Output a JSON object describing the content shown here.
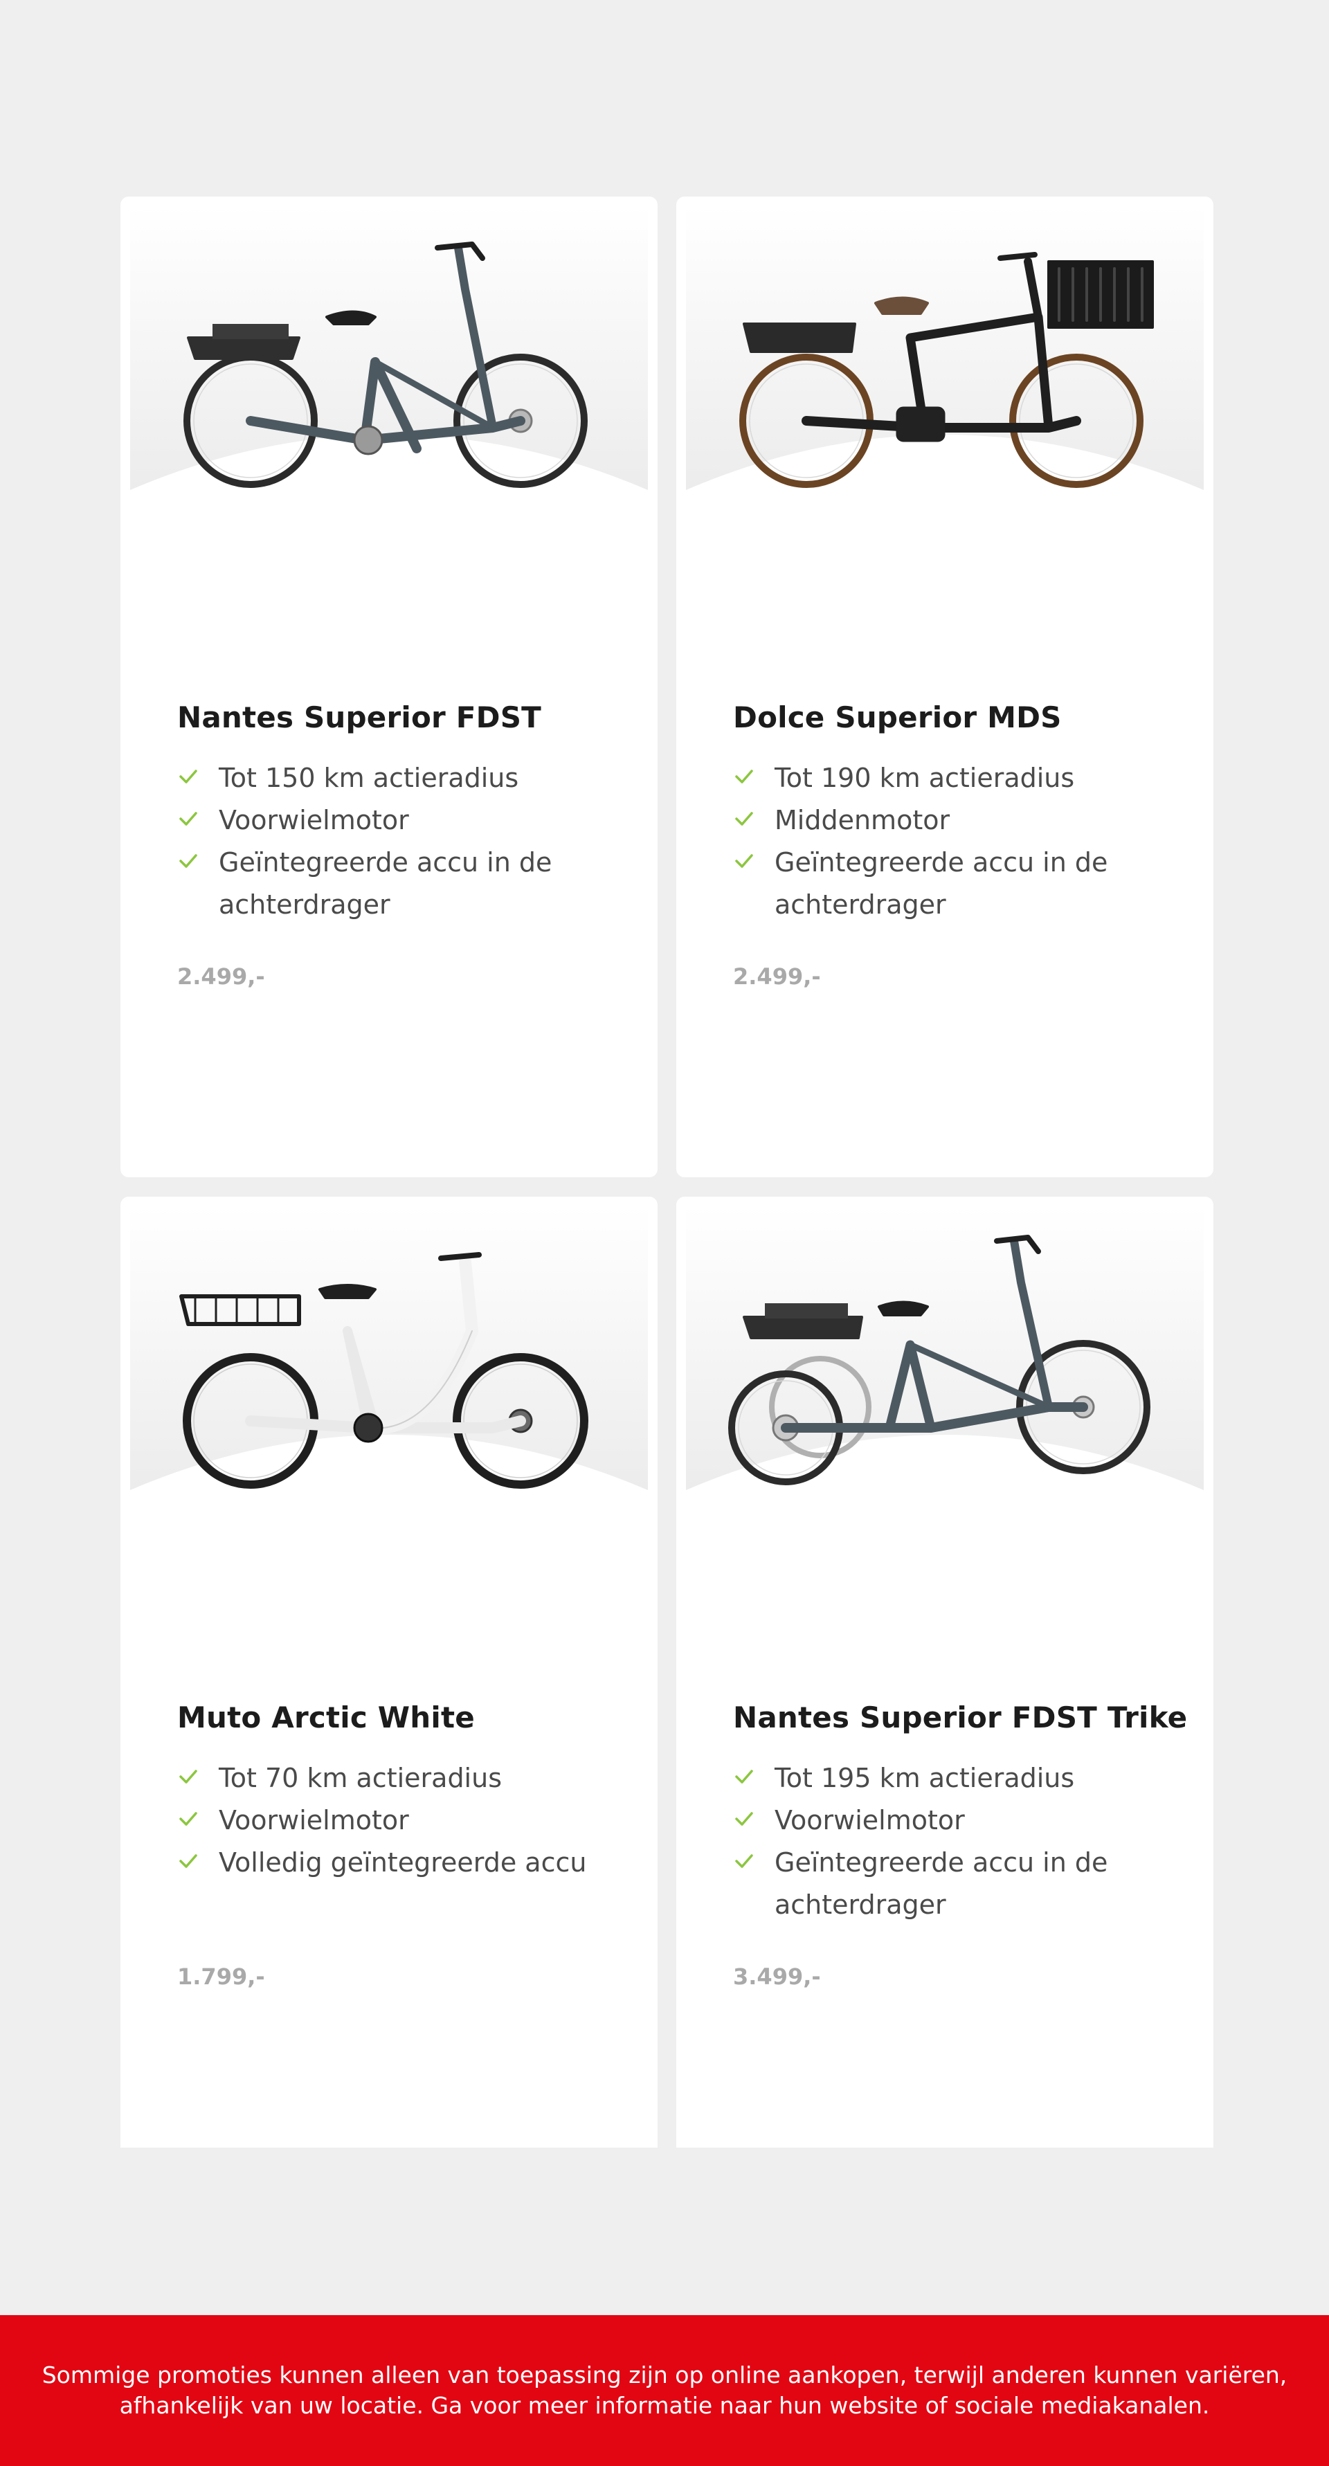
{
  "products": [
    {
      "name": "Nantes Superior FDST",
      "features": [
        "Tot 150 km actieradius",
        "Voorwielmotor",
        "Geïntegreerde accu in de achterdrager"
      ],
      "price": "2.499,-",
      "image": "step-through-ebike-grey-icon"
    },
    {
      "name": "Dolce Superior MDS",
      "features": [
        "Tot 190 km actieradius",
        "Middenmotor",
        "Geïntegreerde accu in de achterdrager"
      ],
      "price": "2.499,-",
      "image": "cargo-crate-ebike-black-icon"
    },
    {
      "name": "Muto Arctic White",
      "features": [
        "Tot 70 km actieradius",
        "Voorwielmotor",
        "Volledig geïntegreerde accu"
      ],
      "price": "1.799,-",
      "image": "white-ebike-with-rack-icon"
    },
    {
      "name": "Nantes Superior FDST Trike",
      "features": [
        "Tot 195 km actieradius",
        "Voorwielmotor",
        "Geïntegreerde accu in de achterdrager"
      ],
      "price": "3.499,-",
      "image": "electric-tricycle-grey-icon"
    }
  ],
  "footer": {
    "disclaimer": "Sommige promoties kunnen alleen van toepassing zijn op online aankopen, terwijl anderen kunnen variëren, afhankelijk van uw locatie. Ga voor meer informatie naar hun website of sociale mediakanalen."
  },
  "colors": {
    "page_background": "#efefef",
    "card_background": "#ffffff",
    "check_green": "#8cc63f",
    "price_grey": "#a9a9a9",
    "banner_red": "#e20613"
  }
}
